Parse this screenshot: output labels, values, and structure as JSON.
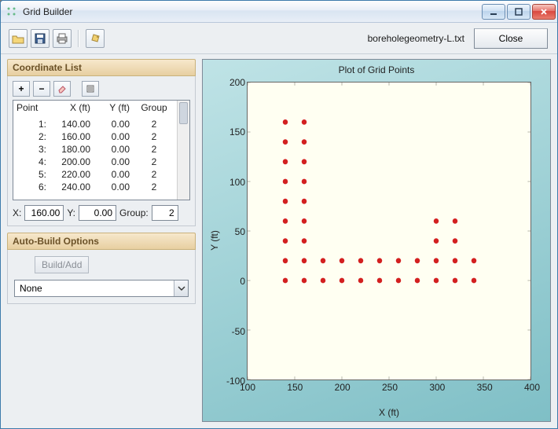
{
  "window": {
    "title": "Grid Builder"
  },
  "toolbar": {
    "filename": "boreholegeometry-L.txt",
    "close_label": "Close"
  },
  "coord_section": {
    "title": "Coordinate List",
    "columns": {
      "point": "Point",
      "x": "X (ft)",
      "y": "Y (ft)",
      "group": "Group"
    },
    "rows": [
      {
        "pt": "1:",
        "x": "140.00",
        "y": "0.00",
        "g": "2"
      },
      {
        "pt": "2:",
        "x": "160.00",
        "y": "0.00",
        "g": "2"
      },
      {
        "pt": "3:",
        "x": "180.00",
        "y": "0.00",
        "g": "2"
      },
      {
        "pt": "4:",
        "x": "200.00",
        "y": "0.00",
        "g": "2"
      },
      {
        "pt": "5:",
        "x": "220.00",
        "y": "0.00",
        "g": "2"
      },
      {
        "pt": "6:",
        "x": "240.00",
        "y": "0.00",
        "g": "2"
      }
    ],
    "edit": {
      "x_label": "X:",
      "x_value": "160.00",
      "y_label": "Y:",
      "y_value": "0.00",
      "g_label": "Group:",
      "g_value": "2"
    }
  },
  "auto_section": {
    "title": "Auto-Build Options",
    "build_label": "Build/Add",
    "combo_value": "None"
  },
  "chart_data": {
    "type": "scatter",
    "title": "Plot of Grid Points",
    "xlabel": "X (ft)",
    "ylabel": "Y (ft)",
    "xlim": [
      100,
      400
    ],
    "ylim": [
      -100,
      200
    ],
    "xticks": [
      100,
      150,
      200,
      250,
      300,
      350,
      400
    ],
    "yticks": [
      -100,
      -50,
      0,
      50,
      100,
      150,
      200
    ],
    "points": [
      [
        140,
        0
      ],
      [
        160,
        0
      ],
      [
        180,
        0
      ],
      [
        200,
        0
      ],
      [
        220,
        0
      ],
      [
        240,
        0
      ],
      [
        260,
        0
      ],
      [
        280,
        0
      ],
      [
        300,
        0
      ],
      [
        320,
        0
      ],
      [
        340,
        0
      ],
      [
        140,
        20
      ],
      [
        160,
        20
      ],
      [
        180,
        20
      ],
      [
        200,
        20
      ],
      [
        220,
        20
      ],
      [
        240,
        20
      ],
      [
        260,
        20
      ],
      [
        280,
        20
      ],
      [
        300,
        20
      ],
      [
        320,
        20
      ],
      [
        340,
        20
      ],
      [
        140,
        40
      ],
      [
        160,
        40
      ],
      [
        300,
        40
      ],
      [
        320,
        40
      ],
      [
        140,
        60
      ],
      [
        160,
        60
      ],
      [
        300,
        60
      ],
      [
        320,
        60
      ],
      [
        140,
        80
      ],
      [
        160,
        80
      ],
      [
        140,
        100
      ],
      [
        160,
        100
      ],
      [
        140,
        120
      ],
      [
        160,
        120
      ],
      [
        140,
        140
      ],
      [
        160,
        140
      ],
      [
        140,
        160
      ],
      [
        160,
        160
      ]
    ]
  }
}
